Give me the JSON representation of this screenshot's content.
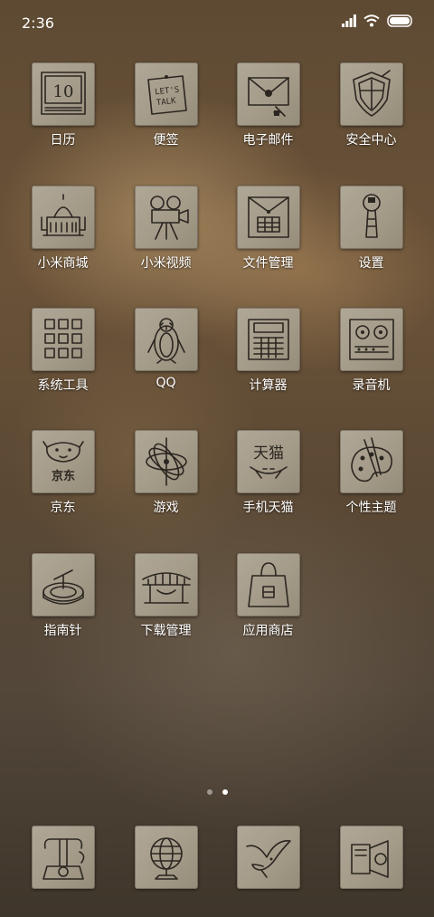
{
  "status_bar": {
    "time": "2:36",
    "icons": [
      "signal-icon",
      "wifi-icon",
      "battery-icon"
    ]
  },
  "apps": [
    {
      "label": "日历",
      "icon": "calendar-icon",
      "day": "10"
    },
    {
      "label": "便签",
      "icon": "notes-icon",
      "note_line1": "LET'S",
      "note_line2": "TALK"
    },
    {
      "label": "电子邮件",
      "icon": "mail-icon"
    },
    {
      "label": "安全中心",
      "icon": "shield-icon"
    },
    {
      "label": "小米商城",
      "icon": "store-building-icon"
    },
    {
      "label": "小米视频",
      "icon": "video-camera-icon"
    },
    {
      "label": "文件管理",
      "icon": "file-box-icon"
    },
    {
      "label": "设置",
      "icon": "wrench-icon"
    },
    {
      "label": "系统工具",
      "icon": "tools-grid-icon"
    },
    {
      "label": "QQ",
      "icon": "penguin-icon"
    },
    {
      "label": "计算器",
      "icon": "calculator-icon"
    },
    {
      "label": "录音机",
      "icon": "recorder-icon"
    },
    {
      "label": "京东",
      "icon": "jd-dog-icon",
      "brand_text": "京东"
    },
    {
      "label": "游戏",
      "icon": "gyroscope-icon"
    },
    {
      "label": "手机天猫",
      "icon": "tmall-icon",
      "brand_text": "天猫"
    },
    {
      "label": "个性主题",
      "icon": "palette-icon"
    },
    {
      "label": "指南针",
      "icon": "compass-icon"
    },
    {
      "label": "下载管理",
      "icon": "download-bridge-icon"
    },
    {
      "label": "应用商店",
      "icon": "shopping-bag-icon"
    }
  ],
  "page_indicator": {
    "count": 2,
    "active": 2
  },
  "dock": [
    {
      "icon": "telephone-icon"
    },
    {
      "icon": "globe-icon"
    },
    {
      "icon": "bird-icon"
    },
    {
      "icon": "camera-icon"
    }
  ]
}
